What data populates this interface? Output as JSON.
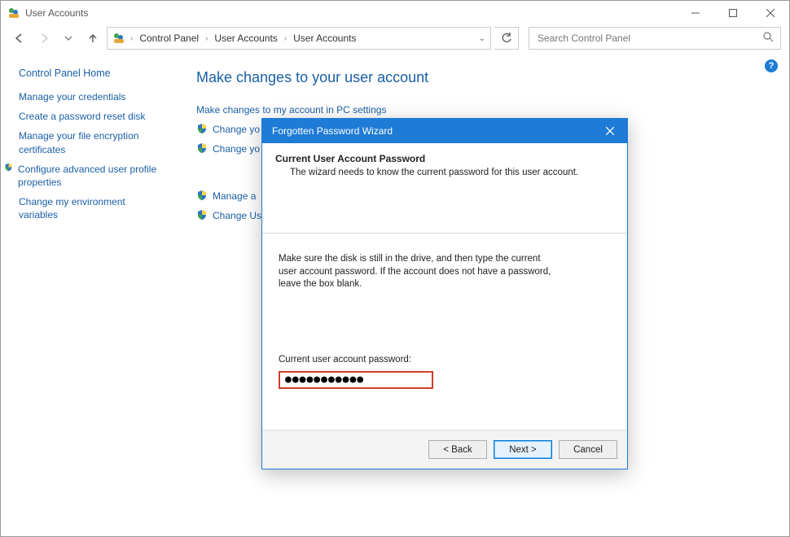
{
  "window": {
    "title": "User Accounts",
    "minimize_tooltip": "Minimize",
    "maximize_tooltip": "Maximize",
    "close_tooltip": "Close"
  },
  "nav": {
    "back_tooltip": "Back",
    "forward_tooltip": "Forward",
    "up_tooltip": "Up",
    "refresh_tooltip": "Refresh",
    "crumbs": [
      "Control Panel",
      "User Accounts",
      "User Accounts"
    ],
    "search_placeholder": "Search Control Panel"
  },
  "sidebar": {
    "home": "Control Panel Home",
    "links": [
      {
        "label": "Manage your credentials",
        "shield": false
      },
      {
        "label": "Create a password reset disk",
        "shield": false
      },
      {
        "label": "Manage your file encryption certificates",
        "shield": false
      },
      {
        "label": "Configure advanced user profile properties",
        "shield": true
      },
      {
        "label": "Change my environment variables",
        "shield": false
      }
    ]
  },
  "main": {
    "heading": "Make changes to your user account",
    "links": [
      {
        "label": "Make changes to my account in PC settings",
        "shield": false
      },
      {
        "label": "Change yo",
        "shield": true
      },
      {
        "label": "Change yo",
        "shield": true
      },
      {
        "label": "Manage a",
        "shield": true
      },
      {
        "label": "Change Us",
        "shield": true
      }
    ]
  },
  "wizard": {
    "title": "Forgotten Password Wizard",
    "head_title": "Current User Account Password",
    "head_sub": "The wizard needs to know the current password for this user account.",
    "instruction": "Make sure the disk is still in the drive, and then type the current user account password. If the account does not have a password, leave the box blank.",
    "field_label": "Current user account password:",
    "password_value": "●●●●●●●●●●●",
    "buttons": {
      "back": "< Back",
      "next": "Next >",
      "cancel": "Cancel"
    }
  },
  "help": "?"
}
